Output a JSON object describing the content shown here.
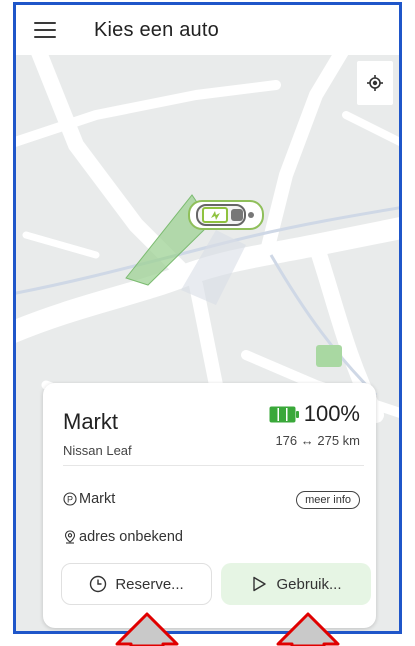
{
  "header": {
    "title": "Kies een auto"
  },
  "car": {
    "name": "Markt",
    "model": "Nissan Leaf",
    "battery_percent": "100%",
    "range": "176 ↔ 275 km",
    "parking_label": "Markt",
    "address": "adres onbekend",
    "info_label": "meer info"
  },
  "actions": {
    "reserve_label": "Reserve...",
    "use_label": "Gebruik..."
  },
  "colors": {
    "frame_border": "#1f56c9",
    "battery_green": "#3aa83a",
    "use_button_bg": "#e6f5e4",
    "annotation_arrow": "#e00000"
  },
  "icons": [
    "menu-icon",
    "my-location-icon",
    "car-marker-icon",
    "battery-icon",
    "parking-icon",
    "location-pin-icon",
    "clock-icon",
    "play-icon"
  ]
}
